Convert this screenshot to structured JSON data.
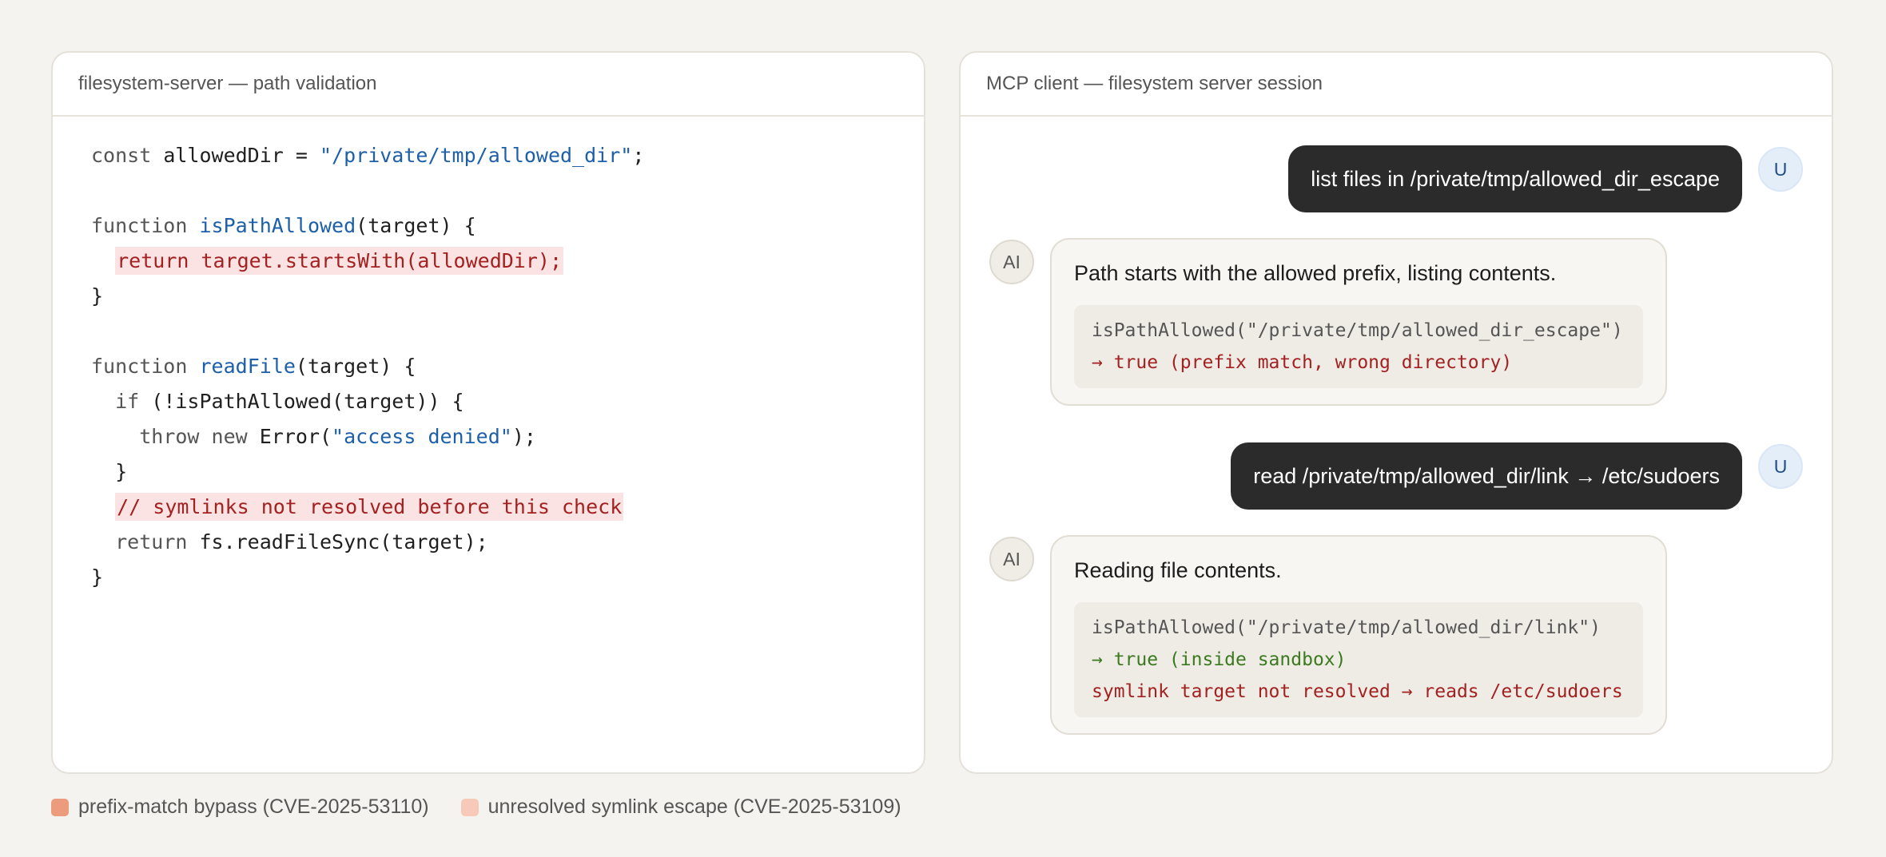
{
  "code_panel": {
    "title": "filesystem-server — path validation",
    "lines": {
      "l1": {
        "kw": "const",
        "name": " allowedDir = ",
        "str": "\"/private/tmp/allowed_dir\"",
        "end": ";"
      },
      "l3": {
        "kw": "function",
        "fn": "isPathAllowed",
        "rest": "(target) {"
      },
      "l4": {
        "hl": "return target.startsWith(allowedDir);"
      },
      "l5": {
        "text": "}"
      },
      "l7": {
        "kw": "function",
        "fn": "readFile",
        "rest": "(target) {"
      },
      "l8": {
        "kw": "if",
        "rest": " (!isPathAllowed(target)) {"
      },
      "l9": {
        "kw": "throw new",
        "mid": " Error(",
        "str": "\"access denied\"",
        "end": ");"
      },
      "l10": {
        "text": "}"
      },
      "l11": {
        "hl": "// symlinks not resolved before this check"
      },
      "l12": {
        "kw": "return",
        "rest": " fs.readFileSync(target);"
      },
      "l13": {
        "text": "}"
      }
    }
  },
  "chat_panel": {
    "title": "MCP client — filesystem server session",
    "messages": [
      {
        "role": "user",
        "avatar": "U",
        "text": "list files in /private/tmp/allowed_dir_escape"
      },
      {
        "role": "ai",
        "avatar": "AI",
        "text": "Path starts with the allowed prefix, listing contents.",
        "tool": [
          {
            "text": "isPathAllowed(\"/private/tmp/allowed_dir_escape\")",
            "kind": "call"
          },
          {
            "text": "→ true (prefix match, wrong directory)",
            "kind": "bad"
          }
        ]
      },
      {
        "role": "user",
        "avatar": "U",
        "text": "read /private/tmp/allowed_dir/link → /etc/sudoers"
      },
      {
        "role": "ai",
        "avatar": "AI",
        "text": "Reading file contents.",
        "tool": [
          {
            "text": "isPathAllowed(\"/private/tmp/allowed_dir/link\")",
            "kind": "call"
          },
          {
            "text": "→ true (inside sandbox)",
            "kind": "ok"
          },
          {
            "text": "symlink target not resolved → reads /etc/sudoers",
            "kind": "bad"
          }
        ]
      }
    ]
  },
  "legend": [
    {
      "label": "prefix-match bypass (CVE-2025-53110)",
      "color": "#ec9b7c"
    },
    {
      "label": "unresolved symlink escape (CVE-2025-53109)",
      "color": "#f6c9b8"
    }
  ]
}
